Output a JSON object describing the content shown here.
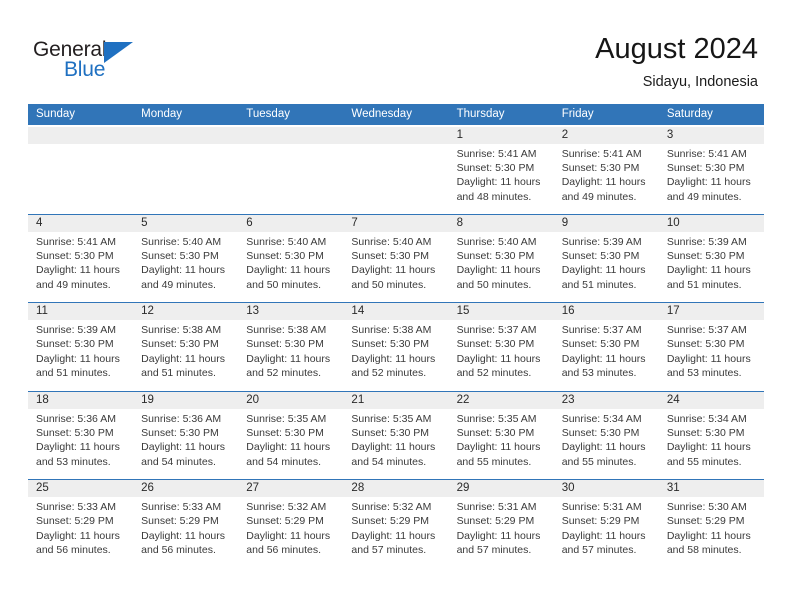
{
  "brand": {
    "name_dark": "General",
    "name_blue": "Blue",
    "accent_color": "#1f70c1"
  },
  "header": {
    "title": "August 2024",
    "subtitle": "Sidayu, Indonesia"
  },
  "theme": {
    "header_blue": "#3175b8",
    "daynum_band": "#eeeeee",
    "text": "#3a3a3a"
  },
  "weekdays": [
    "Sunday",
    "Monday",
    "Tuesday",
    "Wednesday",
    "Thursday",
    "Friday",
    "Saturday"
  ],
  "weeks": [
    [
      {
        "day": "",
        "empty": true
      },
      {
        "day": "",
        "empty": true
      },
      {
        "day": "",
        "empty": true
      },
      {
        "day": "",
        "empty": true
      },
      {
        "day": "1",
        "sunrise": "Sunrise: 5:41 AM",
        "sunset": "Sunset: 5:30 PM",
        "daylight": "Daylight: 11 hours and 48 minutes."
      },
      {
        "day": "2",
        "sunrise": "Sunrise: 5:41 AM",
        "sunset": "Sunset: 5:30 PM",
        "daylight": "Daylight: 11 hours and 49 minutes."
      },
      {
        "day": "3",
        "sunrise": "Sunrise: 5:41 AM",
        "sunset": "Sunset: 5:30 PM",
        "daylight": "Daylight: 11 hours and 49 minutes."
      }
    ],
    [
      {
        "day": "4",
        "sunrise": "Sunrise: 5:41 AM",
        "sunset": "Sunset: 5:30 PM",
        "daylight": "Daylight: 11 hours and 49 minutes."
      },
      {
        "day": "5",
        "sunrise": "Sunrise: 5:40 AM",
        "sunset": "Sunset: 5:30 PM",
        "daylight": "Daylight: 11 hours and 49 minutes."
      },
      {
        "day": "6",
        "sunrise": "Sunrise: 5:40 AM",
        "sunset": "Sunset: 5:30 PM",
        "daylight": "Daylight: 11 hours and 50 minutes."
      },
      {
        "day": "7",
        "sunrise": "Sunrise: 5:40 AM",
        "sunset": "Sunset: 5:30 PM",
        "daylight": "Daylight: 11 hours and 50 minutes."
      },
      {
        "day": "8",
        "sunrise": "Sunrise: 5:40 AM",
        "sunset": "Sunset: 5:30 PM",
        "daylight": "Daylight: 11 hours and 50 minutes."
      },
      {
        "day": "9",
        "sunrise": "Sunrise: 5:39 AM",
        "sunset": "Sunset: 5:30 PM",
        "daylight": "Daylight: 11 hours and 51 minutes."
      },
      {
        "day": "10",
        "sunrise": "Sunrise: 5:39 AM",
        "sunset": "Sunset: 5:30 PM",
        "daylight": "Daylight: 11 hours and 51 minutes."
      }
    ],
    [
      {
        "day": "11",
        "sunrise": "Sunrise: 5:39 AM",
        "sunset": "Sunset: 5:30 PM",
        "daylight": "Daylight: 11 hours and 51 minutes."
      },
      {
        "day": "12",
        "sunrise": "Sunrise: 5:38 AM",
        "sunset": "Sunset: 5:30 PM",
        "daylight": "Daylight: 11 hours and 51 minutes."
      },
      {
        "day": "13",
        "sunrise": "Sunrise: 5:38 AM",
        "sunset": "Sunset: 5:30 PM",
        "daylight": "Daylight: 11 hours and 52 minutes."
      },
      {
        "day": "14",
        "sunrise": "Sunrise: 5:38 AM",
        "sunset": "Sunset: 5:30 PM",
        "daylight": "Daylight: 11 hours and 52 minutes."
      },
      {
        "day": "15",
        "sunrise": "Sunrise: 5:37 AM",
        "sunset": "Sunset: 5:30 PM",
        "daylight": "Daylight: 11 hours and 52 minutes."
      },
      {
        "day": "16",
        "sunrise": "Sunrise: 5:37 AM",
        "sunset": "Sunset: 5:30 PM",
        "daylight": "Daylight: 11 hours and 53 minutes."
      },
      {
        "day": "17",
        "sunrise": "Sunrise: 5:37 AM",
        "sunset": "Sunset: 5:30 PM",
        "daylight": "Daylight: 11 hours and 53 minutes."
      }
    ],
    [
      {
        "day": "18",
        "sunrise": "Sunrise: 5:36 AM",
        "sunset": "Sunset: 5:30 PM",
        "daylight": "Daylight: 11 hours and 53 minutes."
      },
      {
        "day": "19",
        "sunrise": "Sunrise: 5:36 AM",
        "sunset": "Sunset: 5:30 PM",
        "daylight": "Daylight: 11 hours and 54 minutes."
      },
      {
        "day": "20",
        "sunrise": "Sunrise: 5:35 AM",
        "sunset": "Sunset: 5:30 PM",
        "daylight": "Daylight: 11 hours and 54 minutes."
      },
      {
        "day": "21",
        "sunrise": "Sunrise: 5:35 AM",
        "sunset": "Sunset: 5:30 PM",
        "daylight": "Daylight: 11 hours and 54 minutes."
      },
      {
        "day": "22",
        "sunrise": "Sunrise: 5:35 AM",
        "sunset": "Sunset: 5:30 PM",
        "daylight": "Daylight: 11 hours and 55 minutes."
      },
      {
        "day": "23",
        "sunrise": "Sunrise: 5:34 AM",
        "sunset": "Sunset: 5:30 PM",
        "daylight": "Daylight: 11 hours and 55 minutes."
      },
      {
        "day": "24",
        "sunrise": "Sunrise: 5:34 AM",
        "sunset": "Sunset: 5:30 PM",
        "daylight": "Daylight: 11 hours and 55 minutes."
      }
    ],
    [
      {
        "day": "25",
        "sunrise": "Sunrise: 5:33 AM",
        "sunset": "Sunset: 5:29 PM",
        "daylight": "Daylight: 11 hours and 56 minutes."
      },
      {
        "day": "26",
        "sunrise": "Sunrise: 5:33 AM",
        "sunset": "Sunset: 5:29 PM",
        "daylight": "Daylight: 11 hours and 56 minutes."
      },
      {
        "day": "27",
        "sunrise": "Sunrise: 5:32 AM",
        "sunset": "Sunset: 5:29 PM",
        "daylight": "Daylight: 11 hours and 56 minutes."
      },
      {
        "day": "28",
        "sunrise": "Sunrise: 5:32 AM",
        "sunset": "Sunset: 5:29 PM",
        "daylight": "Daylight: 11 hours and 57 minutes."
      },
      {
        "day": "29",
        "sunrise": "Sunrise: 5:31 AM",
        "sunset": "Sunset: 5:29 PM",
        "daylight": "Daylight: 11 hours and 57 minutes."
      },
      {
        "day": "30",
        "sunrise": "Sunrise: 5:31 AM",
        "sunset": "Sunset: 5:29 PM",
        "daylight": "Daylight: 11 hours and 57 minutes."
      },
      {
        "day": "31",
        "sunrise": "Sunrise: 5:30 AM",
        "sunset": "Sunset: 5:29 PM",
        "daylight": "Daylight: 11 hours and 58 minutes."
      }
    ]
  ]
}
